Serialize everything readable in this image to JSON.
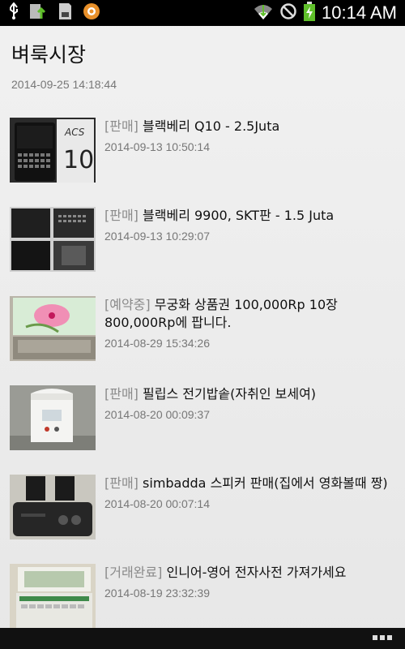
{
  "status_bar": {
    "time": "10:14 AM",
    "left_icons": [
      "usb-icon",
      "file-upload-icon",
      "sd-card-icon",
      "app-notification-icon"
    ],
    "right_icons": [
      "wifi-icon",
      "no-signal-icon",
      "battery-charging-icon"
    ]
  },
  "header": {
    "title": "벼룩시장",
    "updated": "2014-09-25 14:18:44"
  },
  "items": [
    {
      "tag": "[판매]",
      "title": "블랙베리 Q10 - 2.5Juta",
      "date": "2014-09-13 10:50:14",
      "thumbnail": "blackberry-q10-photo"
    },
    {
      "tag": "[판매]",
      "title": "블랙베리 9900, SKT판 - 1.5 Juta",
      "date": "2014-09-13 10:29:07",
      "thumbnail": "blackberry-9900-photo"
    },
    {
      "tag": "[예약중]",
      "title": "무궁화 상품권 100,000Rp 10장 800,000Rp에 팝니다.",
      "date": "2014-08-29 15:34:26",
      "thumbnail": "gift-voucher-photo"
    },
    {
      "tag": "[판매]",
      "title": "필립스 전기밥솥(자취인 보세여)",
      "date": "2014-08-20 00:09:37",
      "thumbnail": "rice-cooker-photo"
    },
    {
      "tag": "[판매]",
      "title": "simbadda 스피커 판매(집에서 영화볼때 짱)",
      "date": "2014-08-20 00:07:14",
      "thumbnail": "speaker-photo"
    },
    {
      "tag": "[거래완료]",
      "title": "인니어-영어 전자사전 가져가세요",
      "date": "2014-08-19 23:32:39",
      "thumbnail": "electronic-dictionary-photo"
    }
  ],
  "bottom_bar": {
    "menu_icon": "overflow-menu-icon"
  }
}
